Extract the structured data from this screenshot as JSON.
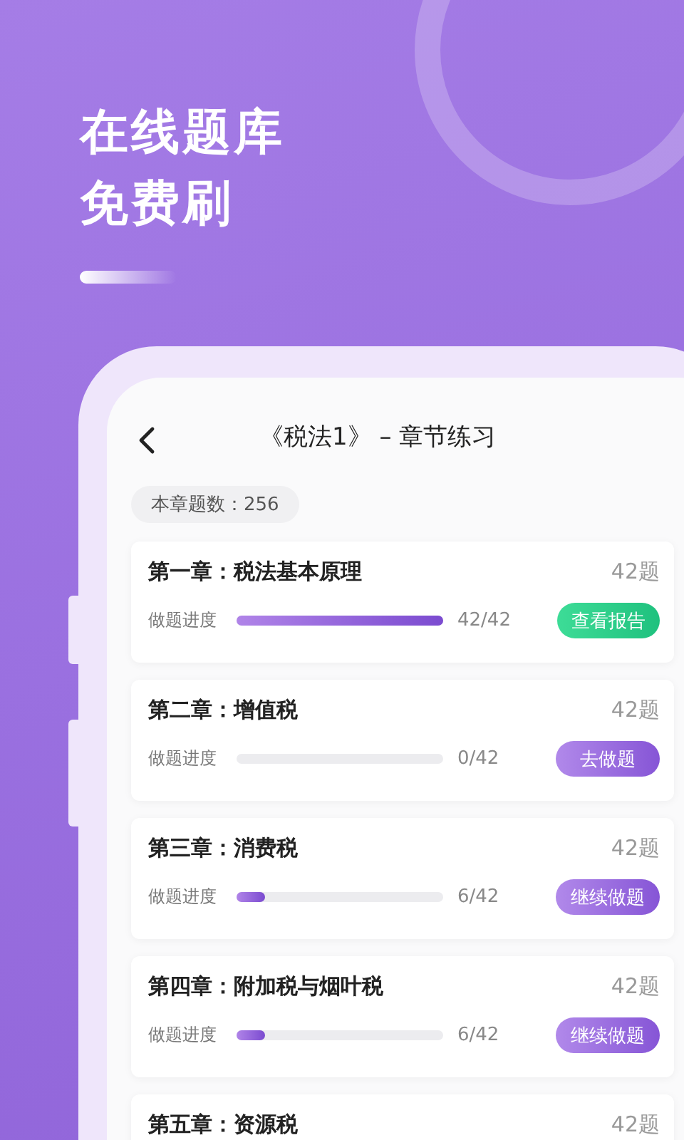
{
  "headline": [
    "在线题库",
    "免费刷"
  ],
  "screen": {
    "title": "《税法1》 – 章节练习",
    "summary": "本章题数：256",
    "chapters": [
      {
        "title": "第一章：税法基本原理",
        "count": "42题",
        "progress_label": "做题进度",
        "level": 1,
        "reading": "42/42",
        "button": {
          "label": "查看报告",
          "kind": "report"
        }
      },
      {
        "title": "第二章：增值税",
        "count": "42题",
        "progress_label": "做题进度",
        "level": 0,
        "reading": "0/42",
        "button": {
          "label": "去做题",
          "kind": "practice"
        }
      },
      {
        "title": "第三章：消费税",
        "count": "42题",
        "progress_label": "做题进度",
        "level": 0.14,
        "reading": "6/42",
        "button": {
          "label": "继续做题",
          "kind": "practice"
        }
      },
      {
        "title": "第四章：附加税与烟叶税",
        "count": "42题",
        "progress_label": "做题进度",
        "level": 0.14,
        "reading": "6/42",
        "button": {
          "label": "继续做题",
          "kind": "practice"
        }
      },
      {
        "title": "第五章：资源税",
        "count": "42题"
      }
    ]
  }
}
